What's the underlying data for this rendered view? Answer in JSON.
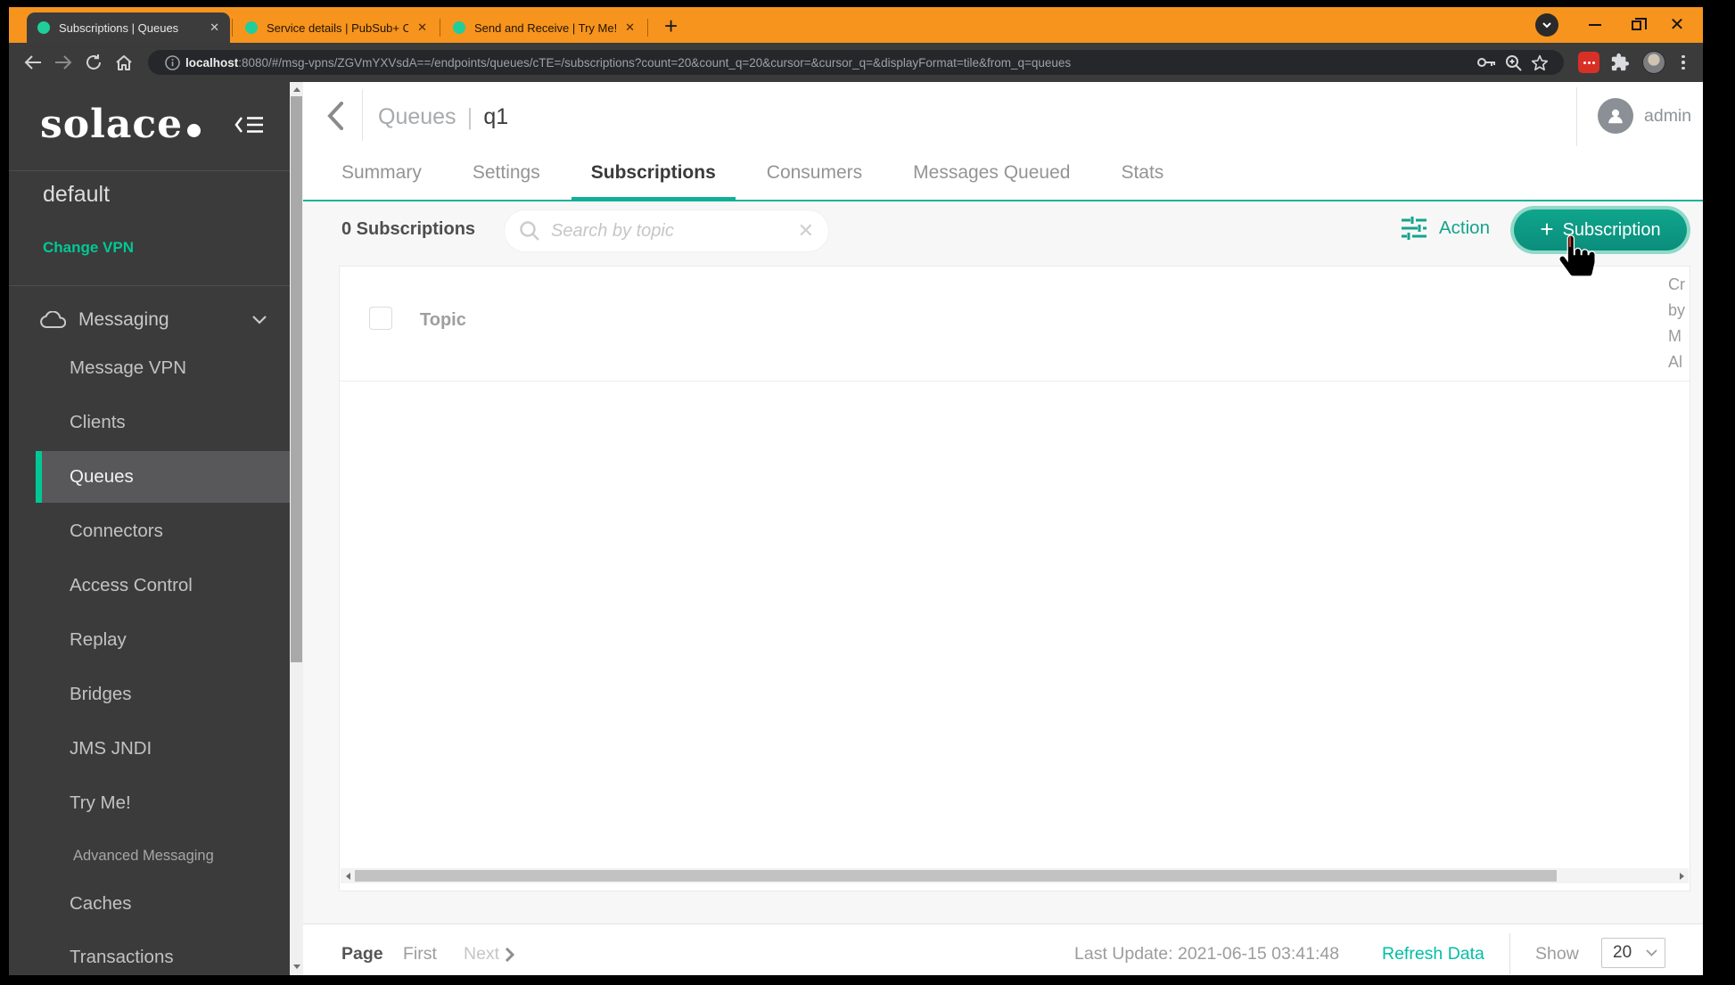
{
  "browser": {
    "tabs": [
      {
        "title": "Subscriptions | Queues"
      },
      {
        "title": "Service details | PubSub+ Cloud"
      },
      {
        "title": "Send and Receive | Try Me!"
      }
    ],
    "url": {
      "host": "localhost",
      "rest": ":8080/#/msg-vpns/ZGVmYXVsdA==/endpoints/queues/cTE=/subscriptions?count=20&count_q=20&cursor=&cursor_q=&displayFormat=tile&from_q=queues"
    }
  },
  "sidebar": {
    "logo_text": "solace",
    "vpn_name": "default",
    "change_vpn_label": "Change VPN",
    "section_label": "Messaging",
    "items": [
      {
        "label": "Message VPN"
      },
      {
        "label": "Clients"
      },
      {
        "label": "Queues"
      },
      {
        "label": "Connectors"
      },
      {
        "label": "Access Control"
      },
      {
        "label": "Replay"
      },
      {
        "label": "Bridges"
      },
      {
        "label": "JMS JNDI"
      },
      {
        "label": "Try Me!"
      },
      {
        "label": "Advanced Messaging"
      },
      {
        "label": "Caches"
      },
      {
        "label": "Transactions"
      }
    ]
  },
  "header": {
    "breadcrumb_parent": "Queues",
    "breadcrumb_current": "q1",
    "user_name": "admin"
  },
  "tabs": [
    {
      "label": "Summary"
    },
    {
      "label": "Settings"
    },
    {
      "label": "Subscriptions"
    },
    {
      "label": "Consumers"
    },
    {
      "label": "Messages Queued"
    },
    {
      "label": "Stats"
    }
  ],
  "toolbar": {
    "count_label": "0 Subscriptions",
    "search_placeholder": "Search by topic",
    "action_label": "Action",
    "add_label": "Subscription"
  },
  "table": {
    "topic_column": "Topic",
    "clipped_column_lines": [
      "Cr",
      "by",
      "M",
      "Al"
    ]
  },
  "footer": {
    "page_label": "Page",
    "first_label": "First",
    "next_label": "Next",
    "last_update": "Last Update: 2021-06-15 03:41:48",
    "refresh_label": "Refresh Data",
    "show_label": "Show",
    "page_size": "20"
  },
  "colors": {
    "chrome_orange": "#F7941D",
    "accent_green": "#00C895",
    "tab_underline": "#10B097",
    "button_teal": "#0C9B84",
    "refresh_teal": "#00BFA4"
  }
}
